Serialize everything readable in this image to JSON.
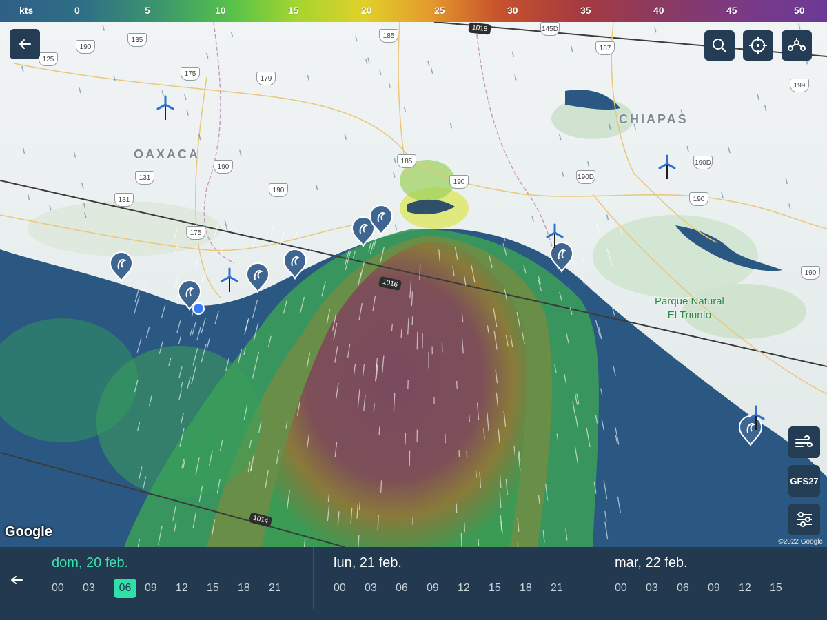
{
  "legend": {
    "unit": "kts",
    "ticks": [
      "0",
      "5",
      "10",
      "15",
      "20",
      "25",
      "30",
      "35",
      "40",
      "45",
      "50"
    ]
  },
  "map": {
    "regions": [
      "OAXACA",
      "CHIAPAS"
    ],
    "park": {
      "line1": "Parque Natural",
      "line2": "El Triunfo"
    },
    "roads": [
      "125",
      "190",
      "135",
      "175",
      "179",
      "185",
      "187",
      "145D",
      "199",
      "131",
      "131",
      "190",
      "190",
      "185",
      "190",
      "190D",
      "190D",
      "190",
      "175",
      "190"
    ],
    "isobars": [
      "1018",
      "1016",
      "1014"
    ],
    "google": "Google",
    "copyright": "©2022 Google",
    "model": "GFS27",
    "colors": {
      "sea": "#2a5a84",
      "calm": "#2f9a5a",
      "mid": "#a8d63a",
      "strong": "#7a4a5a"
    }
  },
  "timeline": {
    "days": [
      {
        "label": "dom, 20 feb.",
        "active": true,
        "hours": [
          "00",
          "03",
          "06",
          "09",
          "12",
          "15",
          "18",
          "21"
        ],
        "selected": "06"
      },
      {
        "label": "lun, 21 feb.",
        "active": false,
        "hours": [
          "00",
          "03",
          "06",
          "09",
          "12",
          "15",
          "18",
          "21"
        ],
        "selected": ""
      },
      {
        "label": "mar, 22 feb.",
        "active": false,
        "hours": [
          "00",
          "03",
          "06",
          "09",
          "12",
          "15"
        ],
        "selected": ""
      }
    ]
  }
}
